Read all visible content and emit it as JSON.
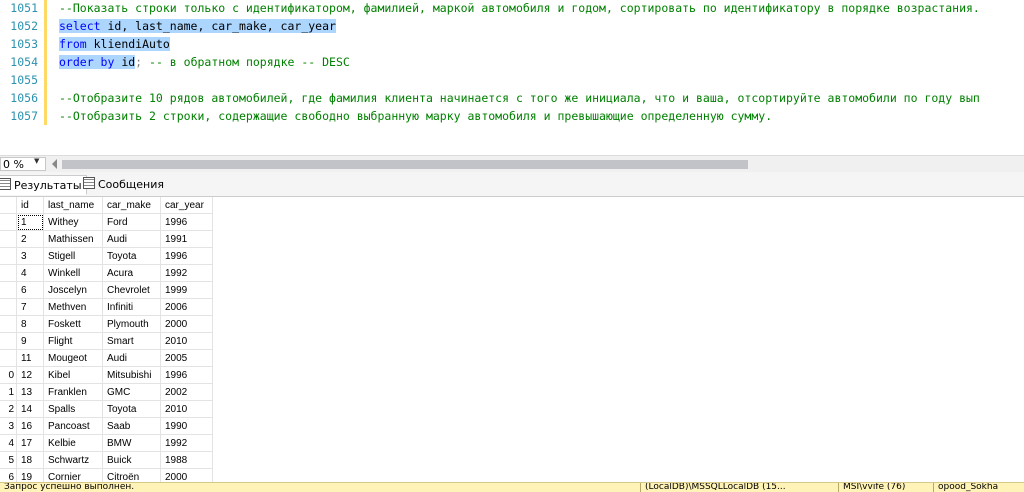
{
  "editor": {
    "lines": [
      {
        "num": "1051",
        "text": "--Показать строки только с идентификатором, фамилией, маркой автомобиля и годом, сортировать по идентификатору в порядке возрастания."
      },
      {
        "num": "1052",
        "kw1": "select",
        "rest": " id, last_name, car_make, car_year"
      },
      {
        "num": "1053",
        "kw1": "from",
        "rest": " kliendiAuto"
      },
      {
        "num": "1054",
        "kw1": "order by",
        "rest": " id",
        "tail": "; ",
        "comment": "-- в обратном порядке -- DESC"
      },
      {
        "num": "1055"
      },
      {
        "num": "1056",
        "text": "--Отобразите 10 рядов автомобилей, где фамилия клиента начинается с того же инициала, что и ваша, отсортируйте автомобили по году вып"
      },
      {
        "num": "1057",
        "text": "--Отобразить 2 строки, содержащие свободно выбранную марку автомобиля и превышающие определенную сумму."
      }
    ]
  },
  "zoom": {
    "value": "0 %"
  },
  "tabs": {
    "results": "Результаты",
    "messages": "Сообщения"
  },
  "grid": {
    "columns": [
      "id",
      "last_name",
      "car_make",
      "car_year"
    ],
    "rows": [
      {
        "rn": "",
        "id": "1",
        "last_name": "Withey",
        "car_make": "Ford",
        "car_year": "1996"
      },
      {
        "rn": "",
        "id": "2",
        "last_name": "Mathissen",
        "car_make": "Audi",
        "car_year": "1991"
      },
      {
        "rn": "",
        "id": "3",
        "last_name": "Stigell",
        "car_make": "Toyota",
        "car_year": "1996"
      },
      {
        "rn": "",
        "id": "4",
        "last_name": "Winkell",
        "car_make": "Acura",
        "car_year": "1992"
      },
      {
        "rn": "",
        "id": "6",
        "last_name": "Joscelyn",
        "car_make": "Chevrolet",
        "car_year": "1999"
      },
      {
        "rn": "",
        "id": "7",
        "last_name": "Methven",
        "car_make": "Infiniti",
        "car_year": "2006"
      },
      {
        "rn": "",
        "id": "8",
        "last_name": "Foskett",
        "car_make": "Plymouth",
        "car_year": "2000"
      },
      {
        "rn": "",
        "id": "9",
        "last_name": "Flight",
        "car_make": "Smart",
        "car_year": "2010"
      },
      {
        "rn": "",
        "id": "11",
        "last_name": "Mougeot",
        "car_make": "Audi",
        "car_year": "2005"
      },
      {
        "rn": "0",
        "id": "12",
        "last_name": "Kibel",
        "car_make": "Mitsubishi",
        "car_year": "1996"
      },
      {
        "rn": "1",
        "id": "13",
        "last_name": "Franklen",
        "car_make": "GMC",
        "car_year": "2002"
      },
      {
        "rn": "2",
        "id": "14",
        "last_name": "Spalls",
        "car_make": "Toyota",
        "car_year": "2010"
      },
      {
        "rn": "3",
        "id": "16",
        "last_name": "Pancoast",
        "car_make": "Saab",
        "car_year": "1990"
      },
      {
        "rn": "4",
        "id": "17",
        "last_name": "Kelbie",
        "car_make": "BMW",
        "car_year": "1992"
      },
      {
        "rn": "5",
        "id": "18",
        "last_name": "Schwartz",
        "car_make": "Buick",
        "car_year": "1988"
      },
      {
        "rn": "6",
        "id": "19",
        "last_name": "Cornier",
        "car_make": "Citroën",
        "car_year": "2000"
      }
    ]
  },
  "status": {
    "message": "Запрос успешно выполнен.",
    "server": "(LocalDB)\\MSSQLLocalDB (15...",
    "user": "MSI\\vvife (76)",
    "db": "opood_Sokha"
  },
  "colors": {
    "selection": "#add6ff",
    "keyword": "#0000ff",
    "comment": "#008000",
    "line_number": "#2b91af",
    "status_bar": "#fff3b8"
  }
}
